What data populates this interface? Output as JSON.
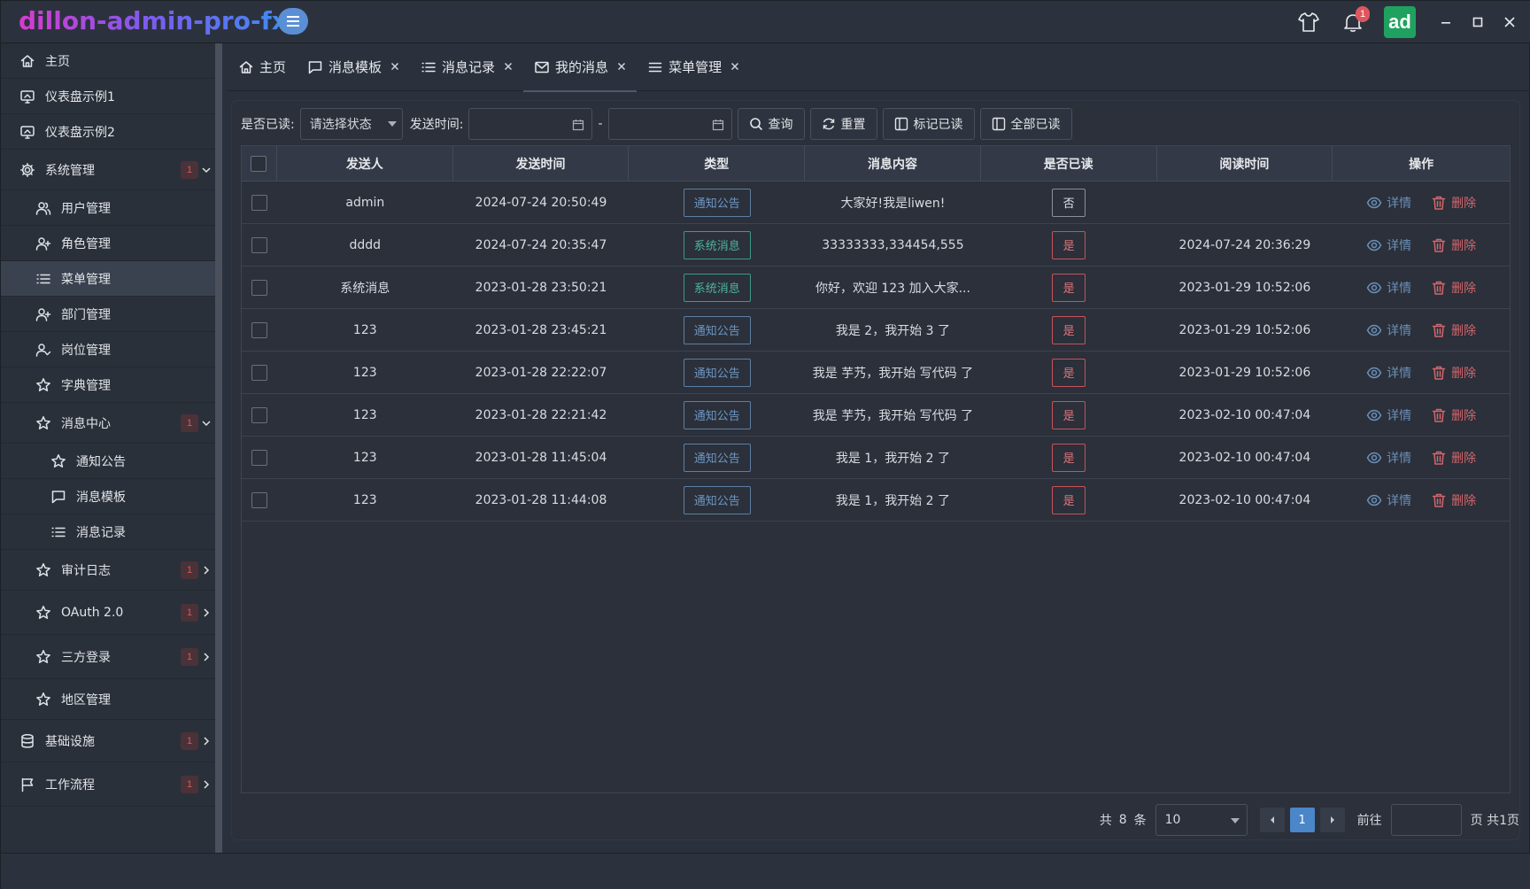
{
  "app": {
    "title": "dillon-admin-pro-fx",
    "bell_count": "1",
    "avatar_text": "ad"
  },
  "sidebar": {
    "items": [
      {
        "label": "主页",
        "icon": "home-icon"
      },
      {
        "label": "仪表盘示例1",
        "icon": "dashboard-icon"
      },
      {
        "label": "仪表盘示例2",
        "icon": "dashboard-icon"
      },
      {
        "label": "系统管理",
        "icon": "gear-icon",
        "badge": "1",
        "expanded": true
      },
      {
        "label": "用户管理",
        "icon": "users-icon"
      },
      {
        "label": "角色管理",
        "icon": "user-plus-icon"
      },
      {
        "label": "菜单管理",
        "icon": "list-icon",
        "active": true
      },
      {
        "label": "部门管理",
        "icon": "user-plus-icon"
      },
      {
        "label": "岗位管理",
        "icon": "user-check-icon"
      },
      {
        "label": "字典管理",
        "icon": "star-icon"
      },
      {
        "label": "消息中心",
        "icon": "star-icon",
        "badge": "1",
        "expanded": true
      },
      {
        "label": "通知公告",
        "icon": "star-icon"
      },
      {
        "label": "消息模板",
        "icon": "chat-icon"
      },
      {
        "label": "消息记录",
        "icon": "list-icon"
      },
      {
        "label": "审计日志",
        "icon": "star-icon",
        "badge": "1"
      },
      {
        "label": "OAuth 2.0",
        "icon": "star-icon",
        "badge": "1"
      },
      {
        "label": "三方登录",
        "icon": "star-icon",
        "badge": "1"
      },
      {
        "label": "地区管理",
        "icon": "star-icon"
      },
      {
        "label": "基础设施",
        "icon": "database-icon",
        "badge": "1"
      },
      {
        "label": "工作流程",
        "icon": "flag-icon",
        "badge": "1"
      }
    ]
  },
  "tabs": [
    {
      "label": "主页",
      "icon": "home-icon",
      "closable": false
    },
    {
      "label": "消息模板",
      "icon": "chat-icon",
      "closable": true
    },
    {
      "label": "消息记录",
      "icon": "list-icon",
      "closable": true
    },
    {
      "label": "我的消息",
      "icon": "mail-icon",
      "closable": true,
      "active": true
    },
    {
      "label": "菜单管理",
      "icon": "menu-icon",
      "closable": true
    }
  ],
  "filter": {
    "read_label": "是否已读:",
    "read_placeholder": "请选择状态",
    "time_label": "发送时间:",
    "range_sep": "-",
    "query": "查询",
    "reset": "重置",
    "mark_read": "标记已读",
    "all_read": "全部已读"
  },
  "table": {
    "headers": [
      "发送人",
      "发送时间",
      "类型",
      "消息内容",
      "是否已读",
      "阅读时间",
      "操作"
    ],
    "detail_label": "详情",
    "delete_label": "删除",
    "rows": [
      {
        "sender": "admin",
        "time": "2024-07-24 20:50:49",
        "type": "通知公告",
        "type_kind": "notice",
        "content": "大家好!我是liwen!",
        "read": "否",
        "read_time": ""
      },
      {
        "sender": "dddd",
        "time": "2024-07-24 20:35:47",
        "type": "系统消息",
        "type_kind": "system",
        "content": "33333333,334454,555",
        "read": "是",
        "read_time": "2024-07-24 20:36:29"
      },
      {
        "sender": "系统消息",
        "time": "2023-01-28 23:50:21",
        "type": "系统消息",
        "type_kind": "system",
        "content": "你好，欢迎 123 加入大家...",
        "read": "是",
        "read_time": "2023-01-29 10:52:06"
      },
      {
        "sender": "123",
        "time": "2023-01-28 23:45:21",
        "type": "通知公告",
        "type_kind": "notice",
        "content": "我是 2，我开始 3 了",
        "read": "是",
        "read_time": "2023-01-29 10:52:06"
      },
      {
        "sender": "123",
        "time": "2023-01-28 22:22:07",
        "type": "通知公告",
        "type_kind": "notice",
        "content": "我是 芋艿，我开始 写代码 了",
        "read": "是",
        "read_time": "2023-01-29 10:52:06"
      },
      {
        "sender": "123",
        "time": "2023-01-28 22:21:42",
        "type": "通知公告",
        "type_kind": "notice",
        "content": "我是 芋艿，我开始 写代码 了",
        "read": "是",
        "read_time": "2023-02-10 00:47:04"
      },
      {
        "sender": "123",
        "time": "2023-01-28 11:45:04",
        "type": "通知公告",
        "type_kind": "notice",
        "content": "我是 1，我开始 2 了",
        "read": "是",
        "read_time": "2023-02-10 00:47:04"
      },
      {
        "sender": "123",
        "time": "2023-01-28 11:44:08",
        "type": "通知公告",
        "type_kind": "notice",
        "content": "我是 1，我开始 2 了",
        "read": "是",
        "read_time": "2023-02-10 00:47:04"
      }
    ]
  },
  "pagination": {
    "total_prefix": "共",
    "total": "8",
    "total_suffix": "条",
    "page_size": "10",
    "current_page": "1",
    "goto_label": "前往",
    "page_suffix": "页 共1页"
  },
  "colors": {
    "accent": "#4a86c8",
    "notice_tag": "#6e97c4",
    "system_tag": "#4db39b",
    "read_yes": "#e0747a",
    "delete": "#d0666d",
    "avatar_bg": "#1fa25f"
  }
}
